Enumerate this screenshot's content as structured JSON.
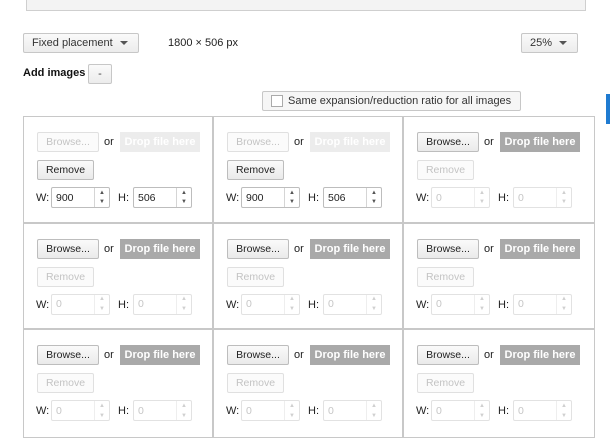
{
  "toolbar": {
    "placement_label": "Fixed placement",
    "dimensions": "1800 × 506 px",
    "zoom_label": "25%"
  },
  "add_images": {
    "label": "Add images",
    "minus_label": "-"
  },
  "ratio_option": {
    "label": "Same expansion/reduction ratio for all images",
    "checked": false
  },
  "cell_labels": {
    "browse": "Browse...",
    "or": "or",
    "drop": "Drop file here",
    "remove": "Remove",
    "w": "W:",
    "h": "H:"
  },
  "cells": [
    {
      "has_image": true,
      "w": "900",
      "h": "506"
    },
    {
      "has_image": true,
      "w": "900",
      "h": "506"
    },
    {
      "has_image": false,
      "w": "0",
      "h": "0"
    },
    {
      "has_image": false,
      "w": "0",
      "h": "0"
    },
    {
      "has_image": false,
      "w": "0",
      "h": "0"
    },
    {
      "has_image": false,
      "w": "0",
      "h": "0"
    },
    {
      "has_image": false,
      "w": "0",
      "h": "0"
    },
    {
      "has_image": false,
      "w": "0",
      "h": "0"
    },
    {
      "has_image": false,
      "w": "0",
      "h": "0"
    }
  ]
}
